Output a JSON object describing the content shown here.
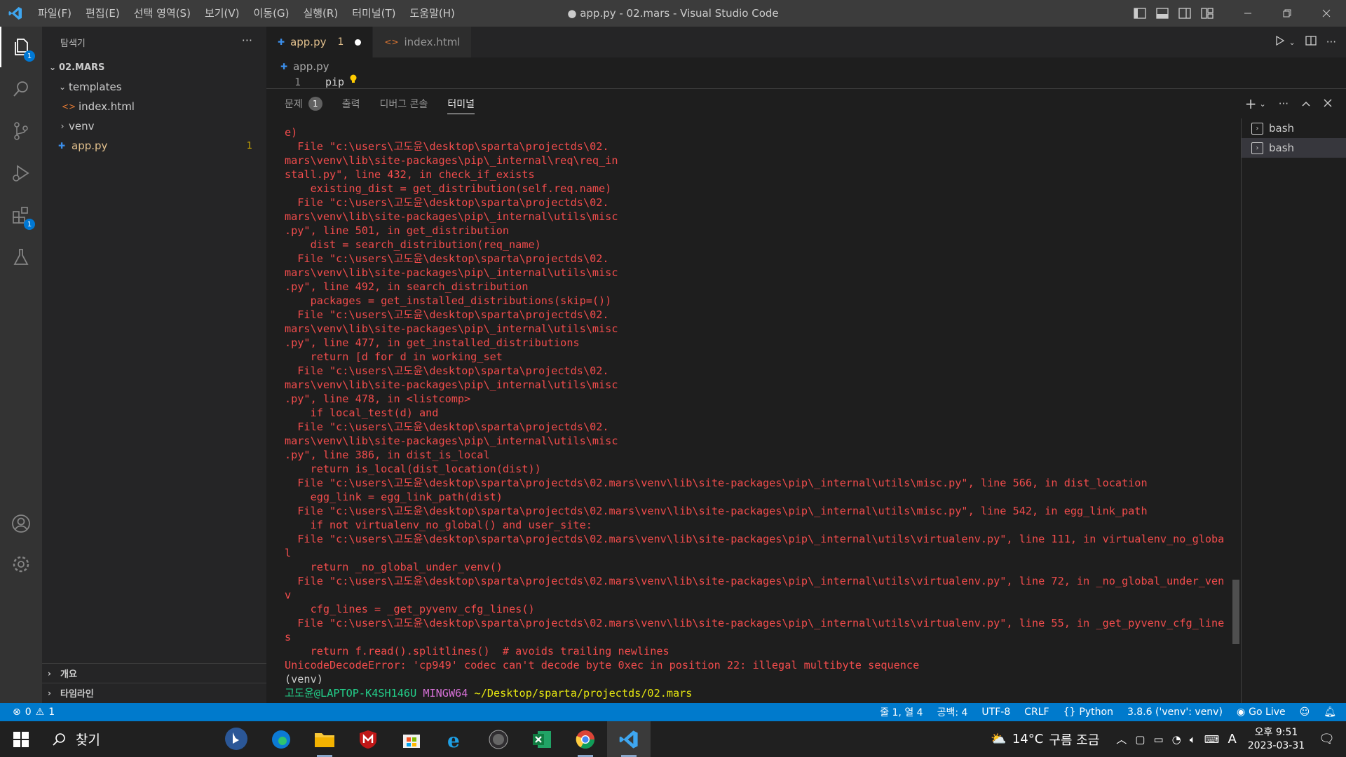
{
  "titlebar": {
    "menus": [
      "파일(F)",
      "편집(E)",
      "선택 영역(S)",
      "보기(V)",
      "이동(G)",
      "실행(R)",
      "터미널(T)",
      "도움말(H)"
    ],
    "title": "● app.py - 02.mars - Visual Studio Code"
  },
  "activitybar": {
    "explorer_badge": "1",
    "extensions_badge": "1"
  },
  "sidebar": {
    "header": "탐색기",
    "more": "···",
    "root": "02.MARS",
    "items": [
      {
        "label": "templates"
      },
      {
        "label": "index.html"
      },
      {
        "label": "venv"
      },
      {
        "label": "app.py",
        "count": "1"
      }
    ],
    "outline": "개요",
    "timeline": "타임라인"
  },
  "editor": {
    "tabs": [
      {
        "label": "app.py",
        "count": "1"
      },
      {
        "label": "index.html"
      }
    ],
    "breadcrumb": "app.py",
    "line_number": "1",
    "code": "pip"
  },
  "panel": {
    "tabs": [
      {
        "label": "문제",
        "badge": "1"
      },
      {
        "label": "출력"
      },
      {
        "label": "디버그 콘솔"
      },
      {
        "label": "터미널"
      }
    ],
    "terminals": [
      "bash",
      "bash"
    ]
  },
  "terminal": {
    "lines": [
      {
        "t": "e)",
        "c": "err"
      },
      {
        "t": "  File \"c:\\users\\고도윤\\desktop\\sparta\\projectds\\02.",
        "c": "err"
      },
      {
        "t": "mars\\venv\\lib\\site-packages\\pip\\_internal\\req\\req_in",
        "c": "err"
      },
      {
        "t": "stall.py\", line 432, in check_if_exists",
        "c": "err"
      },
      {
        "t": "    existing_dist = get_distribution(self.req.name)",
        "c": "err"
      },
      {
        "t": "  File \"c:\\users\\고도윤\\desktop\\sparta\\projectds\\02.",
        "c": "err"
      },
      {
        "t": "mars\\venv\\lib\\site-packages\\pip\\_internal\\utils\\misc",
        "c": "err"
      },
      {
        "t": ".py\", line 501, in get_distribution",
        "c": "err"
      },
      {
        "t": "    dist = search_distribution(req_name)",
        "c": "err"
      },
      {
        "t": "  File \"c:\\users\\고도윤\\desktop\\sparta\\projectds\\02.",
        "c": "err"
      },
      {
        "t": "mars\\venv\\lib\\site-packages\\pip\\_internal\\utils\\misc",
        "c": "err"
      },
      {
        "t": ".py\", line 492, in search_distribution",
        "c": "err"
      },
      {
        "t": "    packages = get_installed_distributions(skip=())",
        "c": "err"
      },
      {
        "t": "  File \"c:\\users\\고도윤\\desktop\\sparta\\projectds\\02.",
        "c": "err"
      },
      {
        "t": "mars\\venv\\lib\\site-packages\\pip\\_internal\\utils\\misc",
        "c": "err"
      },
      {
        "t": ".py\", line 477, in get_installed_distributions",
        "c": "err"
      },
      {
        "t": "    return [d for d in working_set",
        "c": "err"
      },
      {
        "t": "  File \"c:\\users\\고도윤\\desktop\\sparta\\projectds\\02.",
        "c": "err"
      },
      {
        "t": "mars\\venv\\lib\\site-packages\\pip\\_internal\\utils\\misc",
        "c": "err"
      },
      {
        "t": ".py\", line 478, in <listcomp>",
        "c": "err"
      },
      {
        "t": "    if local_test(d) and",
        "c": "err"
      },
      {
        "t": "  File \"c:\\users\\고도윤\\desktop\\sparta\\projectds\\02.",
        "c": "err"
      },
      {
        "t": "mars\\venv\\lib\\site-packages\\pip\\_internal\\utils\\misc",
        "c": "err"
      },
      {
        "t": ".py\", line 386, in dist_is_local",
        "c": "err"
      },
      {
        "t": "    return is_local(dist_location(dist))",
        "c": "err"
      },
      {
        "t": "  File \"c:\\users\\고도윤\\desktop\\sparta\\projectds\\02.mars\\venv\\lib\\site-packages\\pip\\_internal\\utils\\misc.py\", line 566, in dist_location",
        "c": "err"
      },
      {
        "t": "    egg_link = egg_link_path(dist)",
        "c": "err"
      },
      {
        "t": "  File \"c:\\users\\고도윤\\desktop\\sparta\\projectds\\02.mars\\venv\\lib\\site-packages\\pip\\_internal\\utils\\misc.py\", line 542, in egg_link_path",
        "c": "err"
      },
      {
        "t": "    if not virtualenv_no_global() and user_site:",
        "c": "err"
      },
      {
        "t": "  File \"c:\\users\\고도윤\\desktop\\sparta\\projectds\\02.mars\\venv\\lib\\site-packages\\pip\\_internal\\utils\\virtualenv.py\", line 111, in virtualenv_no_globa",
        "c": "err"
      },
      {
        "t": "l",
        "c": "err"
      },
      {
        "t": "    return _no_global_under_venv()",
        "c": "err"
      },
      {
        "t": "  File \"c:\\users\\고도윤\\desktop\\sparta\\projectds\\02.mars\\venv\\lib\\site-packages\\pip\\_internal\\utils\\virtualenv.py\", line 72, in _no_global_under_ven",
        "c": "err"
      },
      {
        "t": "v",
        "c": "err"
      },
      {
        "t": "    cfg_lines = _get_pyvenv_cfg_lines()",
        "c": "err"
      },
      {
        "t": "  File \"c:\\users\\고도윤\\desktop\\sparta\\projectds\\02.mars\\venv\\lib\\site-packages\\pip\\_internal\\utils\\virtualenv.py\", line 55, in _get_pyvenv_cfg_line",
        "c": "err"
      },
      {
        "t": "s",
        "c": "err"
      },
      {
        "t": "    return f.read().splitlines()  # avoids trailing newlines",
        "c": "err"
      },
      {
        "t": "UnicodeDecodeError: 'cp949' codec can't decode byte 0xec in position 22: illegal multibyte sequence",
        "c": "err"
      },
      {
        "t": "(venv)",
        "c": "plain"
      }
    ],
    "prompt": {
      "user": "고도윤@LAPTOP-K4SH146U",
      "shell": "MINGW64",
      "path": "~/Desktop/sparta/projectds/02.mars"
    }
  },
  "statusbar": {
    "errors": "0",
    "warnings": "1",
    "position": "줄 1, 열 4",
    "spaces": "공백: 4",
    "encoding": "UTF-8",
    "eol": "CRLF",
    "language": "Python",
    "interpreter": "3.8.6 ('venv': venv)",
    "golive": "Go Live"
  },
  "taskbar": {
    "search": "찾기",
    "weather_temp": "14°C",
    "weather_desc": "구름 조금",
    "ime": "A",
    "time": "오후 9:51",
    "date": "2023-03-31"
  },
  "colors": {
    "accent": "#007acc",
    "error_text": "#f14c4c",
    "modified": "#e2c08d"
  }
}
